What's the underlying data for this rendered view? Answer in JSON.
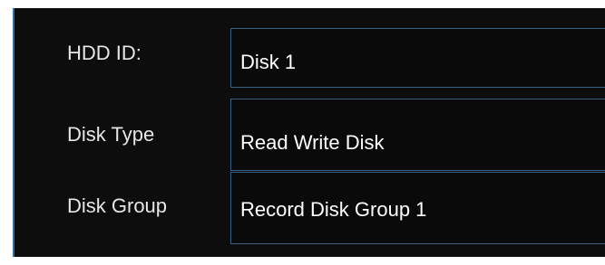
{
  "disk_info": {
    "hdd_id": {
      "label": "HDD ID:",
      "value": "Disk 1"
    },
    "disk_type": {
      "label": "Disk Type",
      "value": "Read Write Disk"
    },
    "disk_group": {
      "label": "Disk Group",
      "value": "Record Disk Group 1"
    }
  },
  "colors": {
    "background": "#0d0d0d",
    "accent_border": "#2f6fa8",
    "field_border": "#3a5f86",
    "text": "#ffffff"
  }
}
